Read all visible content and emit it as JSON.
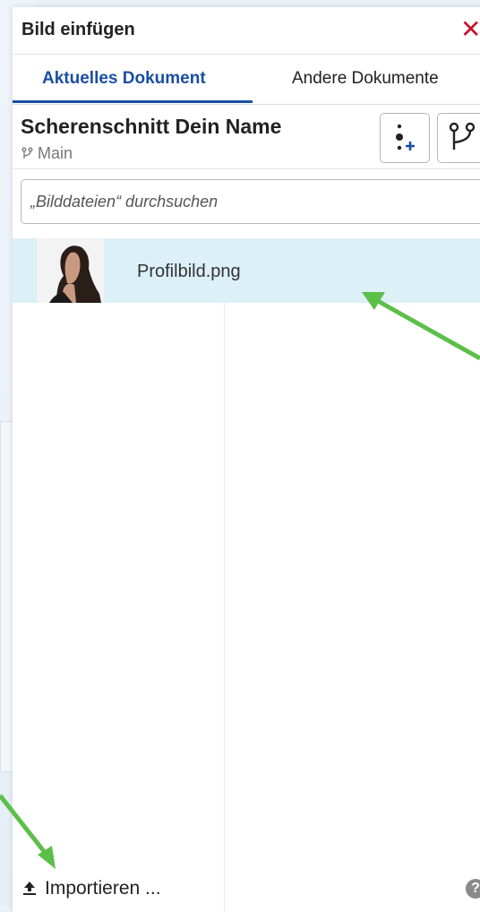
{
  "dialog": {
    "title": "Bild einfügen",
    "close_icon": "close-icon"
  },
  "tabs": [
    {
      "label": "Aktuelles Dokument",
      "active": true
    },
    {
      "label": "Andere Dokumente",
      "active": false
    }
  ],
  "document": {
    "name": "Scherenschnitt Dein Name",
    "branch": "Main",
    "buttons": [
      {
        "icon": "version-add-icon"
      },
      {
        "icon": "branch-icon"
      }
    ]
  },
  "search": {
    "placeholder": "„Bilddateien“ durchsuchen"
  },
  "files": [
    {
      "name": "Profilbild.png",
      "thumbnail_icon": "profile-photo-thumbnail"
    }
  ],
  "footer": {
    "import_label": "Importieren ...",
    "help_icon": "help-icon"
  },
  "colors": {
    "accent": "#1a4fa3",
    "close": "#c8102e",
    "selected_row": "#dcf0f8",
    "annotation_arrow": "#5cbf4a"
  }
}
